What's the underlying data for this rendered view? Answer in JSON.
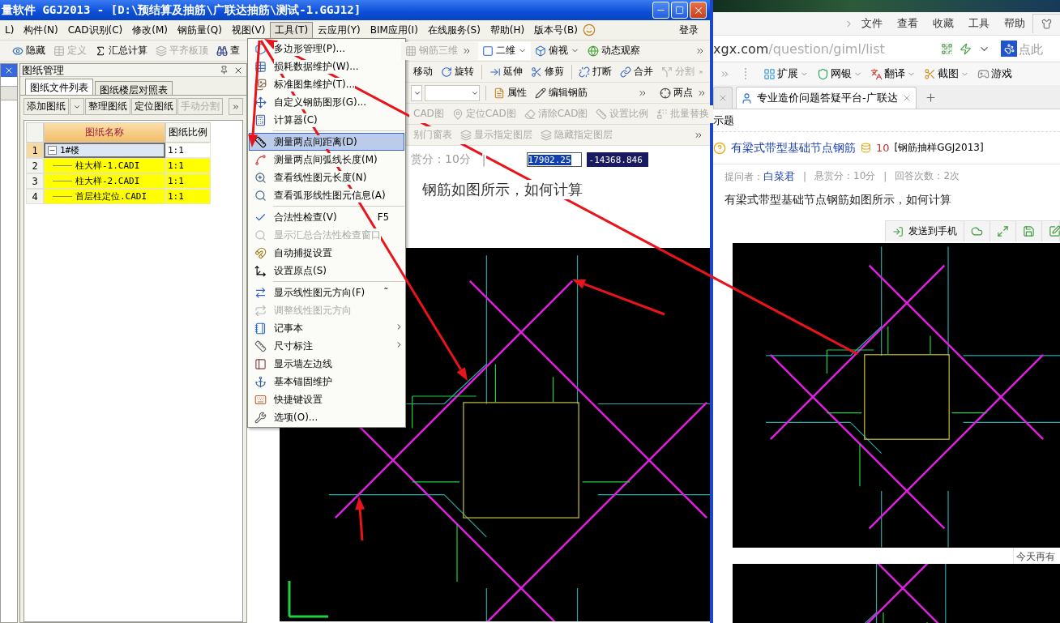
{
  "app_window": {
    "title": "量软件 GGJ2013 - [D:\\预结算及抽筋\\广联达抽筋\\测试-1.GGJ12]",
    "menu": [
      {
        "label": "L)",
        "selected": false
      },
      {
        "label": "构件(N)",
        "selected": false
      },
      {
        "label": "CAD识别(C)",
        "selected": false
      },
      {
        "label": "修改(M)",
        "selected": false
      },
      {
        "label": "钢筋量(Q)",
        "selected": false
      },
      {
        "label": "视图(V)",
        "selected": false
      },
      {
        "label": "工具(T)",
        "selected": true
      },
      {
        "label": "云应用(Y)",
        "selected": false
      },
      {
        "label": "BIM应用(I)",
        "selected": false
      },
      {
        "label": "在线服务(S)",
        "selected": false
      },
      {
        "label": "帮助(H)",
        "selected": false
      },
      {
        "label": "版本号(B)",
        "selected": false
      }
    ],
    "login": "登录",
    "toolbar_main": [
      {
        "label": "隐藏",
        "disabled": false
      },
      {
        "label": "定义",
        "disabled": true
      },
      {
        "label": "汇总计算",
        "disabled": false
      },
      {
        "label": "平齐板顶",
        "disabled": true
      },
      {
        "label": "查",
        "disabled": false
      }
    ],
    "toolbar_view": [
      {
        "label": "钢筋三维",
        "disabled": true,
        "dropdown": false
      },
      {
        "label": "二维",
        "disabled": false,
        "dropdown": true
      },
      {
        "label": "俯视",
        "disabled": false,
        "dropdown": true
      },
      {
        "label": "动态观察",
        "disabled": false,
        "dropdown": false
      }
    ],
    "toolbar_edit": [
      {
        "label": "移动",
        "disabled": false
      },
      {
        "label": "旋转",
        "disabled": false
      },
      {
        "label": "延伸",
        "disabled": false
      },
      {
        "label": "修剪",
        "disabled": false
      },
      {
        "label": "打断",
        "disabled": false
      },
      {
        "label": "合并",
        "disabled": false
      },
      {
        "label": "分割",
        "disabled": true
      }
    ],
    "toolbar_props": [
      {
        "label": "属性",
        "disabled": false
      },
      {
        "label": "编辑钢筋",
        "disabled": false
      },
      {
        "label": "两点",
        "disabled": false
      }
    ],
    "toolbar_cad": [
      {
        "label": "CAD图",
        "disabled": true
      },
      {
        "label": "定位CAD图",
        "disabled": true
      },
      {
        "label": "清除CAD图",
        "disabled": true
      },
      {
        "label": "设置比例",
        "disabled": true
      },
      {
        "label": "批量替换",
        "disabled": true
      }
    ],
    "toolbar_layers": [
      {
        "label": "别门窗表",
        "disabled": true
      },
      {
        "label": "显示指定图层",
        "disabled": true
      },
      {
        "label": "隐藏指定图层",
        "disabled": true
      }
    ],
    "tools_menu": [
      [
        {
          "label": "多边形管理(P)...",
          "disabled": false,
          "selected": false,
          "submenu": false
        },
        {
          "label": "损耗数据维护(W)...",
          "disabled": false,
          "selected": false,
          "submenu": false
        },
        {
          "label": "标准图集维护(T)...",
          "disabled": false,
          "selected": false,
          "submenu": false
        },
        {
          "label": "自定义钢筋图形(G)...",
          "disabled": false,
          "selected": false,
          "submenu": false
        },
        {
          "label": "计算器(C)",
          "disabled": false,
          "selected": false,
          "submenu": false
        }
      ],
      [
        {
          "label": "测量两点间距离(D)",
          "disabled": false,
          "selected": true,
          "submenu": false
        },
        {
          "label": "测量两点间弧线长度(M)",
          "disabled": false,
          "selected": false,
          "submenu": false
        },
        {
          "label": "查看线性图元长度(N)",
          "disabled": false,
          "selected": false,
          "submenu": false
        },
        {
          "label": "查看弧形线性图元信息(A)",
          "disabled": false,
          "selected": false,
          "submenu": false
        }
      ],
      [
        {
          "label": "合法性检查(V)",
          "shortcut": "F5",
          "disabled": false,
          "selected": false,
          "submenu": false
        },
        {
          "label": "显示汇总合法性检查窗口",
          "disabled": true,
          "selected": false,
          "submenu": false
        },
        {
          "label": "自动捕捉设置",
          "disabled": false,
          "selected": false,
          "submenu": false
        },
        {
          "label": "设置原点(S)",
          "disabled": false,
          "selected": false,
          "submenu": false
        }
      ],
      [
        {
          "label": "显示线性图元方向(F)",
          "shortcut": "˜",
          "disabled": false,
          "selected": false,
          "submenu": false
        },
        {
          "label": "调整线性图元方向",
          "disabled": true,
          "selected": false,
          "submenu": false
        },
        {
          "label": "记事本",
          "disabled": false,
          "selected": false,
          "submenu": true
        },
        {
          "label": "尺寸标注",
          "disabled": false,
          "selected": false,
          "submenu": true
        },
        {
          "label": "显示墙左边线",
          "disabled": false,
          "selected": false,
          "submenu": false
        },
        {
          "label": "基本锚固维护",
          "disabled": false,
          "selected": false,
          "submenu": false
        },
        {
          "label": "快捷键设置",
          "disabled": false,
          "selected": false,
          "submenu": false
        },
        {
          "label": "选项(O)...",
          "disabled": false,
          "selected": false,
          "submenu": false
        }
      ]
    ],
    "drawing_panel": {
      "title": "图纸管理",
      "tabs": [
        {
          "label": "图纸文件列表",
          "selected": true
        },
        {
          "label": "图纸楼层对照表",
          "selected": false
        }
      ],
      "buttons": [
        {
          "label": "添加图纸",
          "disabled": false
        },
        {
          "label": "整理图纸",
          "disabled": false
        },
        {
          "label": "定位图纸",
          "disabled": false
        },
        {
          "label": "手动分割",
          "disabled": true
        }
      ],
      "columns": [
        "图纸名称",
        "图纸比例"
      ],
      "rows": [
        {
          "number": "1",
          "name": "1#楼",
          "scale": "1:1",
          "selected": true,
          "expanded": true,
          "children": [
            {
              "number": "2",
              "name": "柱大样-1.CADI",
              "scale": "1:1",
              "selected": false
            },
            {
              "number": "3",
              "name": "柱大样-2.CADI",
              "scale": "1:1",
              "selected": false
            },
            {
              "number": "4",
              "name": "首层柱定位.CADI",
              "scale": "1:1",
              "selected": false
            }
          ]
        }
      ]
    },
    "canvas": {
      "reward": "赏分：10分",
      "divider": "|",
      "x_coordinate": "17902.25",
      "y_coordinate": "-14368.846",
      "question": "钢筋如图所示，如何计算"
    }
  },
  "browser": {
    "menu": [
      "文件",
      "查看",
      "收藏",
      "工具",
      "帮助"
    ],
    "url_host": "xgx.com",
    "url_path": "/question/giml/list",
    "search": {
      "placeholder": "点此"
    },
    "bookmarks": [
      {
        "label": "扩展",
        "dropdown": true
      },
      {
        "label": "网银",
        "dropdown": true
      },
      {
        "label": "翻译",
        "dropdown": true
      },
      {
        "label": "截图",
        "dropdown": true
      },
      {
        "label": "游戏",
        "dropdown": false
      }
    ],
    "tabs": [
      {
        "selected": false
      },
      {
        "title": "专业造价问题答疑平台-广联达",
        "selected": true
      }
    ],
    "page": {
      "breadcrumb": "示题",
      "question_title": "有梁式带型基础节点钢筋",
      "reward_points": "10",
      "category": "[钢筋抽样GGJ2013]",
      "meta": [
        {
          "kind": "asker",
          "label": "提问者：",
          "value": "白菜君"
        },
        {
          "kind": "separator",
          "label": "|"
        },
        {
          "kind": "text",
          "label": "悬赏分：10分"
        },
        {
          "kind": "separator",
          "label": "|"
        },
        {
          "kind": "text",
          "label": "回答次数：2次"
        }
      ],
      "body": "有梁式带型基础节点钢筋如图所示，如何计算",
      "send_to_phone": "发送到手机",
      "side_snippet": "今天再有"
    }
  }
}
